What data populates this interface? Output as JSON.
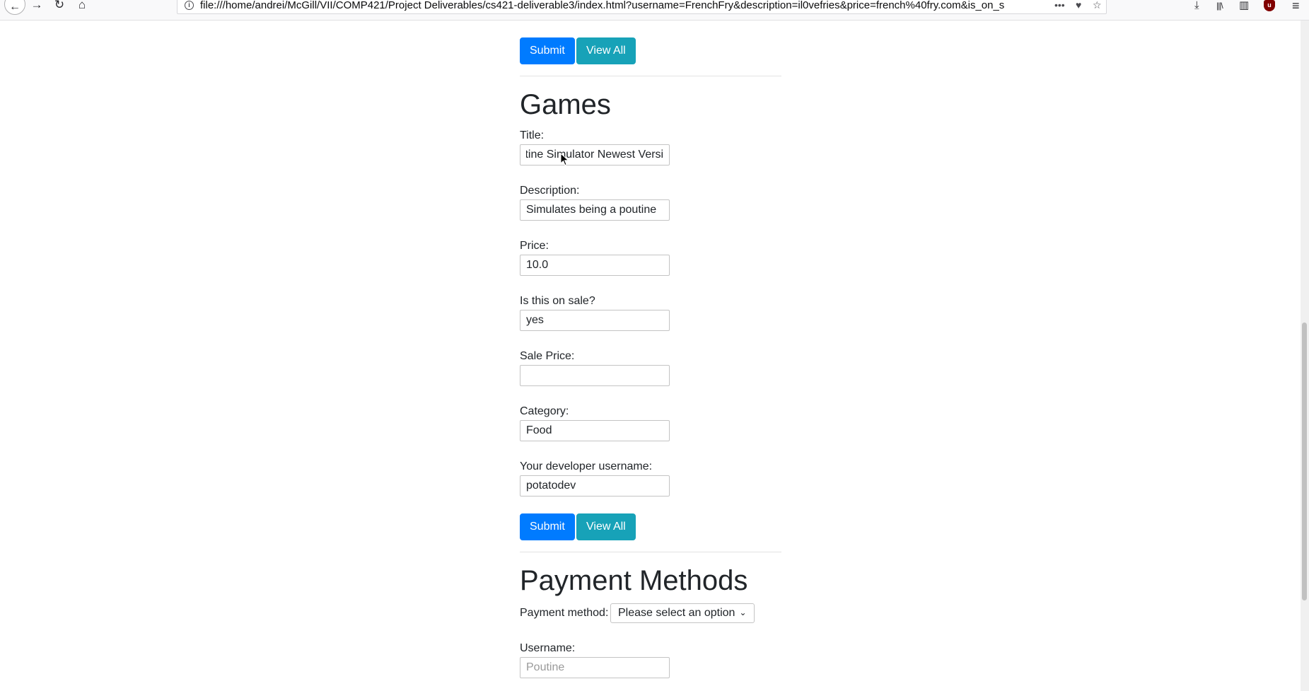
{
  "browser": {
    "url": "file:///home/andrei/McGill/VII/COMP421/Project Deliverables/cs421-deliverable3/index.html?username=FrenchFry&description=il0vefries&price=french%40fry.com&is_on_s",
    "back_icon": "←",
    "forward_icon": "→",
    "reload_icon": "↻",
    "home_icon": "⌂",
    "info_icon": "i",
    "more_icon": "•••",
    "pocket_icon": "♥",
    "bookmark_icon": "☆",
    "download_icon": "⤓",
    "library_icon": "|||\\",
    "sidebar_icon": "▥",
    "ublock_icon": "u",
    "menu_icon": "≡"
  },
  "top_actions": {
    "submit_label": "Submit",
    "view_all_label": "View All"
  },
  "games": {
    "heading": "Games",
    "title_label": "Title:",
    "title_value": "Poutine Simulator Newest Version",
    "description_label": "Description:",
    "description_value": "Simulates being a poutine",
    "price_label": "Price:",
    "price_value": "10.0",
    "on_sale_label": "Is this on sale?",
    "on_sale_value": "yes",
    "sale_price_label": "Sale Price:",
    "sale_price_value": "",
    "category_label": "Category:",
    "category_value": "Food",
    "dev_username_label": "Your developer username:",
    "dev_username_value": "potatodev",
    "submit_label": "Submit",
    "view_all_label": "View All"
  },
  "payment": {
    "heading": "Payment Methods",
    "method_label": "Payment method:",
    "method_selected": "Please select an option",
    "username_label": "Username:",
    "username_placeholder": "Poutine"
  },
  "colors": {
    "primary": "#007bff",
    "info": "#17a2b8"
  }
}
